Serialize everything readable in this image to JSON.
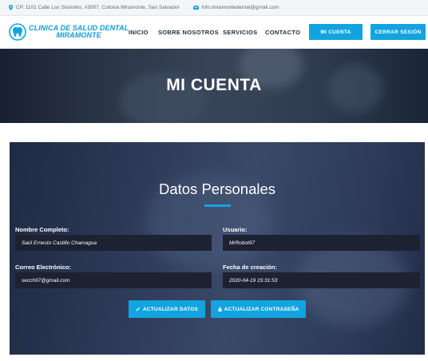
{
  "topbar": {
    "address": "CP. 1101 Calle Los Sisimiles, #3007, Colonia Miramonte, San Salvador",
    "email": "info.miramontedental@gmail.com",
    "address_icon": "map-pin-icon",
    "email_icon": "envelope-icon"
  },
  "logo": {
    "line1": "CLINICA DE SALUD DENTAL",
    "line2": "MIRAMONTE",
    "icon": "tooth-icon"
  },
  "nav": {
    "items": [
      "INICIO",
      "SOBRE NOSOTROS",
      "SERVICIOS",
      "CONTACTO"
    ],
    "account_button": "MI CUENTA",
    "logout_button": "CERRAR SESIÓN"
  },
  "hero": {
    "title": "MI CUENTA"
  },
  "profile": {
    "title": "Datos Personales",
    "fields": [
      {
        "label": "Nombre Completo:",
        "value": "Saúl Ernesto Castillo Chamagua"
      },
      {
        "label": "Usuario:",
        "value": "MrRobot97"
      },
      {
        "label": "Correo Electrónico:",
        "value": "secch97@gmail.com"
      },
      {
        "label": "Fecha de creación:",
        "value": "2020-04-19 15:31:53"
      }
    ],
    "update_data_button": "ACTUALIZAR DATOS",
    "update_password_button": "ACTUALIZAR CONTRASEÑA",
    "update_data_icon": "pencil-icon",
    "update_password_icon": "lock-icon"
  },
  "colors": {
    "accent": "#12a4e0",
    "nav_text": "#1e2d3b",
    "field_bg": "#1c2232"
  }
}
